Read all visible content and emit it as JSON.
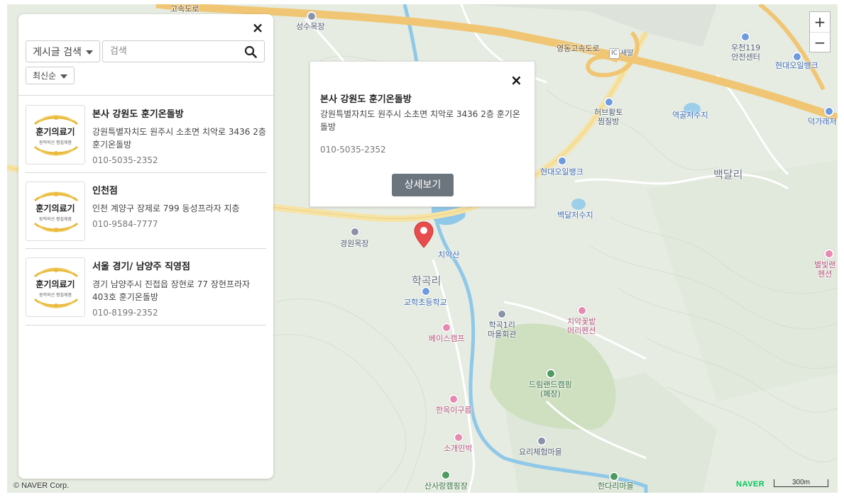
{
  "map": {
    "labels": {
      "expressway_top": "영동고속도로",
      "ic_badge": "IC",
      "saemal": "새말",
      "seongsu": "성수목장",
      "ujeon119": "우천119\n안전센터",
      "hyundai_oil_top": "현대오일뱅크",
      "herb": "허브황토\n찜질방",
      "yeokgol": "역골저수지",
      "deokgarae": "덕가래저",
      "hyundai_oil_mid": "현대오일뱅크",
      "baekdalri": "백달리",
      "baekdal_res": "백달저수지",
      "gyeongwon": "경원목장",
      "chiaksan": "치악산",
      "hakgokri": "학곡리",
      "gyohak": "교학초등학교",
      "hakgok_hall": "학곡1리\n마을회관",
      "chiak_kkot": "치악꽃밭\n머리펜션",
      "byeolbit": "별빛랜\n펜션",
      "base_camp": "베이스캠프",
      "dreamland": "드림랜드캠핑\n(폐장)",
      "hanok": "한옥이구름",
      "sogae": "소개민박",
      "yori": "요리체험마을",
      "sansarang": "산사랑캠핑장",
      "handari": "한다리마을",
      "expressway_tl": "고속도로"
    },
    "copyright": "© NAVER Corp.",
    "brand": "NAVER",
    "scale": "300m",
    "zoom_in": "+",
    "zoom_out": "−"
  },
  "panel": {
    "close": "×",
    "search_type": "게시글 검색",
    "search_placeholder": "검색",
    "sort": "최신순",
    "logo_text": "훈기의료기",
    "logo_sub": "원적외선 찜질제품",
    "items": [
      {
        "name": "본사 강원도 훈기온돌방",
        "address": "강원특별자치도 원주시 소초면 치악로 3436 2층 훈기온돌방",
        "phone": "010-5035-2352"
      },
      {
        "name": "인천점",
        "address": "인천 계양구 장제로 799 동성프라자 지층",
        "phone": "010-9584-7777"
      },
      {
        "name": "서울 경기/ 남양주 직영점",
        "address": "경기 남양주시 진접읍 장현로 77 장현프라자 403호 훈기온돌방",
        "phone": "010-8199-2352"
      }
    ]
  },
  "popup": {
    "close": "×",
    "title": "본사 강원도 훈기온돌방",
    "address": "강원특별자치도 원주시 소초면 치악로 3436 2층 훈기온돌방",
    "phone": "010-5035-2352",
    "button": "상세보기"
  },
  "colors": {
    "expressway": "#f0c674",
    "road": "#f7e3a3",
    "river": "#8fc8e8",
    "forest": "#d8e4cf",
    "button": "#6c757d",
    "pin": "#e84c4c"
  }
}
